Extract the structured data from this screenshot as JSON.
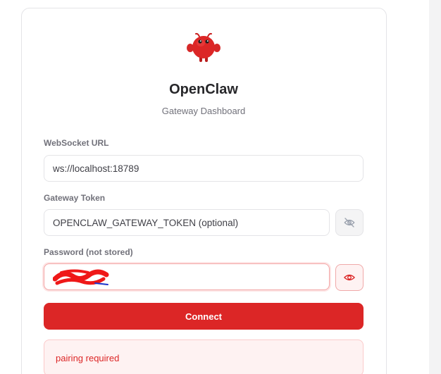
{
  "app": {
    "title": "OpenClaw",
    "subtitle": "Gateway Dashboard",
    "logo_icon": "red-lobster-mascot-icon",
    "accent_color": "#dc2626"
  },
  "form": {
    "websocket": {
      "label": "WebSocket URL",
      "value": "ws://localhost:18789"
    },
    "token": {
      "label": "Gateway Token",
      "value": "OPENCLAW_GATEWAY_TOKEN (optional)",
      "toggle_icon": "eye-off-icon"
    },
    "password": {
      "label": "Password (not stored)",
      "value": "",
      "toggle_icon": "eye-icon"
    },
    "connect_label": "Connect"
  },
  "status": {
    "error": "pairing required"
  }
}
